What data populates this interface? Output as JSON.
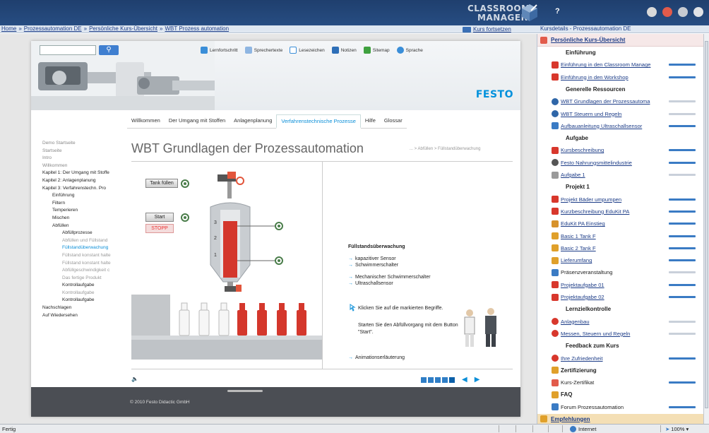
{
  "header": {
    "brand_line1": "CLASSROOM",
    "brand_line2": "MANAGER"
  },
  "breadcrumb": {
    "items": [
      "Home",
      "Prozessautomation DE",
      "Persönliche Kurs-Übersicht",
      "WBT Prozess automation"
    ],
    "continue_label": "Kurs fortsetzen",
    "course_details": "Kursdetails - Prozessautomation DE"
  },
  "wbt": {
    "toolbar": [
      "Lernfortschritt",
      "Sprechertexte",
      "Lesezeichen",
      "Notizen",
      "Sitemap",
      "Sprache"
    ],
    "logo": "FESTO",
    "tabs": [
      "Willkommen",
      "Der Umgang mit Stoffen",
      "Anlagenplanung",
      "Verfahrenstechnische Prozesse",
      "Hilfe",
      "Glossar"
    ],
    "active_tab": "Verfahrenstechnische Prozesse",
    "nav": [
      "Demo Startseite",
      "Startseite",
      "Intro",
      "Willkommen",
      "Kapitel 1: Der Umgang mit Stoffe",
      "Kapitel 2: Anlagenplanung",
      "Kapitel 3: Verfahrenstechn. Pro",
      "Einführung",
      "Filtern",
      "Temperieren",
      "Mischen",
      "Abfüllen",
      "Abfüllprozesse",
      "Abfüllen und Füllstand",
      "Füllstandüberwachung",
      "Füllstand konstant halte",
      "Füllstand konstant halte",
      "Abfüllgeschwindigkeit c",
      "Das fertige Produkt",
      "Kontrollaufgabe",
      "Kontrollaufgabe",
      "Kontrollaufgabe",
      "Nachschlagen",
      "Auf Wiedersehen"
    ],
    "title": "WBT Grundlagen der Prozessautomation",
    "page_crumb": "... > Abfüllen > Füllstandüberwachung",
    "buttons": {
      "tank": "Tank füllen",
      "start": "Start",
      "stop": "STOPP"
    },
    "level_marks": [
      "3",
      "2",
      "1"
    ],
    "info": {
      "title": "Füllstandsüberwachung",
      "links_a": [
        "kapazitiver Sensor",
        "Schwimmerschalter"
      ],
      "links_b": [
        "Mechanischer Schwimmerschalter",
        "Ultraschallsensor"
      ],
      "hint1": "Klicken Sie auf die markierten Begriffe.",
      "hint2": "Starten Sie den Abfüllvorgang mit dem Button \"Start\".",
      "anim_link": "Animationserläuterung"
    },
    "copyright": "© 2010 Festo Didactic GmbH"
  },
  "sidebar": {
    "top": "Persönliche Kurs-Übersicht",
    "rows": [
      {
        "type": "head",
        "label": "Einführung"
      },
      {
        "type": "item",
        "icon": "pdf",
        "label": "Einführung in den Classroom Manage",
        "bar": "blue"
      },
      {
        "type": "item",
        "icon": "pdf",
        "label": "Einführung in den Workshop",
        "bar": "blue"
      },
      {
        "type": "head",
        "label": "Generelle Ressourcen"
      },
      {
        "type": "item",
        "icon": "wbt",
        "label": "WBT Grundlagen der Prozessautoma",
        "bar": "gray"
      },
      {
        "type": "item",
        "icon": "wbt",
        "label": "WBT Steuern und Regeln",
        "bar": "gray"
      },
      {
        "type": "item",
        "icon": "doc",
        "label": "Aufbauanleitung Ultraschallsensor",
        "bar": "blue"
      },
      {
        "type": "head",
        "label": "Aufgabe"
      },
      {
        "type": "item",
        "icon": "pdf",
        "label": "Kursbeschreibung",
        "bar": "blue"
      },
      {
        "type": "item",
        "icon": "link",
        "label": "Festo Nahrungsmittelindustrie",
        "bar": "blue"
      },
      {
        "type": "item",
        "icon": "task",
        "label": "Aufgabe 1",
        "bar": "gray"
      },
      {
        "type": "head",
        "label": "Projekt 1"
      },
      {
        "type": "item",
        "icon": "pdf",
        "label": "Projekt Bäder umpumpen",
        "bar": "blue"
      },
      {
        "type": "item",
        "icon": "pdf",
        "label": "Kurzbeschreibung EduKit PA",
        "bar": "blue"
      },
      {
        "type": "item",
        "icon": "img",
        "label": "EduKit PA Einstieg",
        "bar": "blue"
      },
      {
        "type": "item",
        "icon": "hat",
        "label": "Basic 1 Tank F",
        "bar": "blue"
      },
      {
        "type": "item",
        "icon": "hat",
        "label": "Basic 2 Tank F",
        "bar": "blue"
      },
      {
        "type": "item",
        "icon": "hat",
        "label": "Lieferumfang",
        "bar": "blue"
      },
      {
        "type": "item",
        "icon": "cal",
        "label": "Präsenzveranstaltung",
        "bar": "gray",
        "plain": true
      },
      {
        "type": "item",
        "icon": "pdf",
        "label": "Projektaufgabe 01",
        "bar": "blue"
      },
      {
        "type": "item",
        "icon": "pdf",
        "label": "Projektaufgabe 02",
        "bar": "blue"
      },
      {
        "type": "head",
        "label": "Lernzielkontrolle"
      },
      {
        "type": "item",
        "icon": "q",
        "label": "Anlagenbau",
        "bar": "gray"
      },
      {
        "type": "item",
        "icon": "q",
        "label": "Messen, Steuern und Regeln",
        "bar": "gray"
      },
      {
        "type": "head",
        "label": "Feedback zum Kurs"
      },
      {
        "type": "item",
        "icon": "q",
        "label": "Ihre Zufriedenheit",
        "bar": "blue"
      },
      {
        "type": "head2",
        "icon": "lock",
        "label": "Zertifizierung"
      },
      {
        "type": "item",
        "icon": "cert",
        "label": "Kurs-Zertifikat",
        "bar": "blue",
        "plain": true
      },
      {
        "type": "head2",
        "icon": "lock",
        "label": "FAQ"
      },
      {
        "type": "item",
        "icon": "forum",
        "label": "Forum Prozessautomation",
        "bar": "blue",
        "plain": true
      }
    ],
    "bottom": "Empfehlungen"
  },
  "statusbar": {
    "left": "Fertig",
    "zone": "Internet",
    "zoom": "100%"
  }
}
